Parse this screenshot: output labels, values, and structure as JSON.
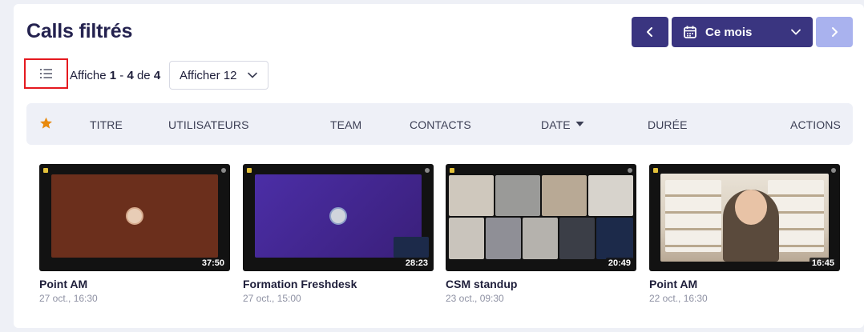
{
  "page": {
    "title": "Calls filtrés"
  },
  "period": {
    "label": "Ce mois"
  },
  "pagination": {
    "prefix": "Affiche",
    "start": "1",
    "sep": "-",
    "end": "4",
    "of": "de",
    "total": "4"
  },
  "per_page": {
    "label": "Afficher 12"
  },
  "columns": {
    "titre": "TITRE",
    "utilisateurs": "UTILISATEURS",
    "team": "TEAM",
    "contacts": "CONTACTS",
    "date": "DATE",
    "duree": "DURÉE",
    "actions": "ACTIONS"
  },
  "calls": [
    {
      "title": "Point AM",
      "date": "27 oct., 16:30",
      "duration": "37:50"
    },
    {
      "title": "Formation Freshdesk",
      "date": "27 oct., 15:00",
      "duration": "28:23"
    },
    {
      "title": "CSM standup",
      "date": "23 oct., 09:30",
      "duration": "20:49"
    },
    {
      "title": "Point AM",
      "date": "22 oct., 16:30",
      "duration": "16:45"
    }
  ],
  "colors": {
    "primary": "#3a3580",
    "primary_disabled": "#a9b2ee",
    "star": "#e8890c",
    "highlight_border": "#e5191f"
  },
  "icons": {
    "prev": "chevron-left-icon",
    "next": "chevron-right-icon",
    "calendar": "calendar-icon",
    "dropdown": "chevron-down-icon",
    "list_view": "list-icon",
    "star": "star-icon",
    "sort": "sort-desc-icon"
  }
}
